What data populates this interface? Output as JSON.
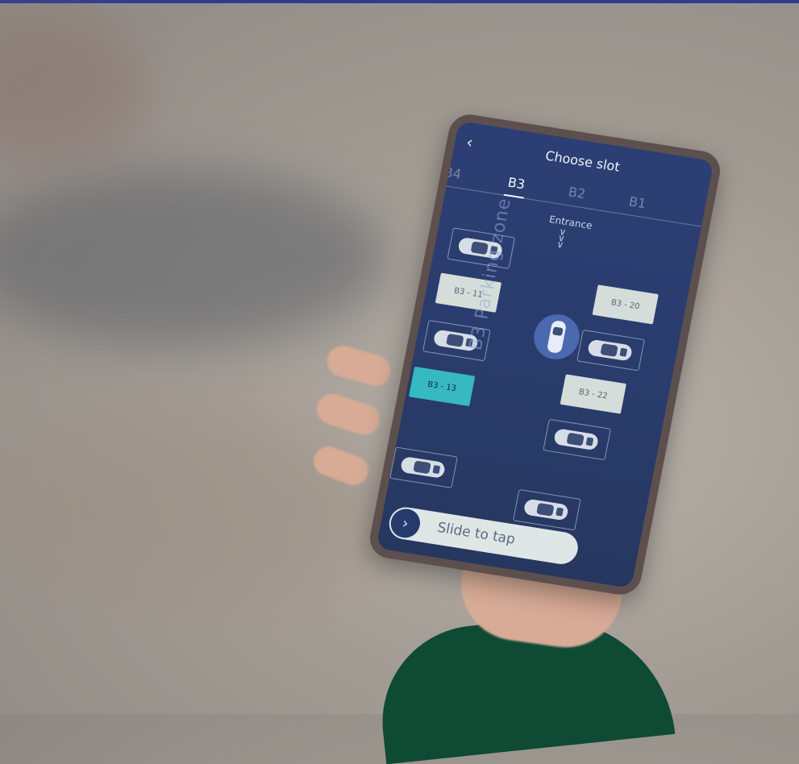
{
  "app": {
    "title": "Choose slot",
    "back_icon": "chevron-left-icon"
  },
  "tabs": [
    {
      "label": "B4",
      "active": false
    },
    {
      "label": "B3",
      "active": true
    },
    {
      "label": "B2",
      "active": false
    },
    {
      "label": "B1",
      "active": false
    }
  ],
  "map": {
    "entrance_label": "Entrance",
    "zone_label": "B3 Parking zone",
    "open_slots": [
      {
        "label": "B3 - 11",
        "selected": false
      },
      {
        "label": "B3 - 13",
        "selected": true
      },
      {
        "label": "B3 - 20",
        "selected": false
      },
      {
        "label": "B3 - 22",
        "selected": false
      }
    ]
  },
  "slider": {
    "label": "Slide to tap",
    "icon": "chevron-right-icon"
  },
  "colors": {
    "screen_bg": "#2c3f74",
    "selected_slot": "#37b9c1",
    "open_slot": "#d4ddd9"
  }
}
